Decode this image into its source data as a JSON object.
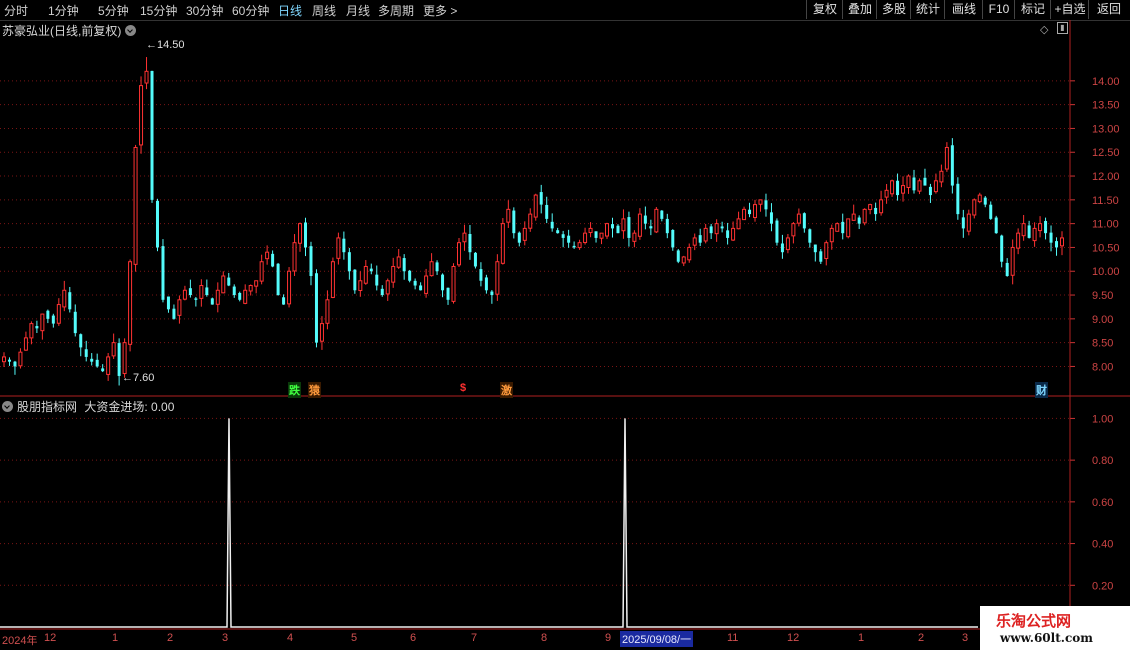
{
  "toolbar": {
    "periods": [
      "分时",
      "1分钟",
      "5分钟",
      "15分钟",
      "30分钟",
      "60分钟",
      "日线",
      "周线",
      "月线",
      "多周期",
      "更多"
    ],
    "active_period": "日线",
    "buttons": [
      "复权",
      "叠加",
      "多股",
      "统计",
      "画线",
      "F10",
      "标记",
      "+自选",
      "返回"
    ]
  },
  "main": {
    "title": "苏豪弘业(日线,前复权)",
    "high_label": "14.50",
    "low_label": "7.60",
    "signals": [
      {
        "text": "跌",
        "color": "#40ff40"
      },
      {
        "text": "猿",
        "color": "#ff9a3c"
      },
      {
        "text": "$",
        "color": "#ff3030"
      },
      {
        "text": "激",
        "color": "#ff9a3c"
      },
      {
        "text": "财",
        "color": "#7fd7ff"
      }
    ]
  },
  "indicator": {
    "title": "股朋指标网",
    "name_value": "大资金进场: 0.00"
  },
  "dates": {
    "labels": [
      "2024年",
      "12",
      "1",
      "2",
      "3",
      "4",
      "5",
      "6",
      "7",
      "8",
      "9",
      "2025/09/08/一",
      "11",
      "12",
      "1",
      "2",
      "3"
    ],
    "selected": "2025/09/08/一"
  },
  "watermark": {
    "line1": "乐淘公式网",
    "line2": "www.60lt.com"
  },
  "chart_data": [
    {
      "type": "candlestick",
      "title": "苏豪弘业(日线,前复权)",
      "y_ticks": [
        "8.00",
        "8.50",
        "9.00",
        "9.50",
        "10.00",
        "10.50",
        "11.00",
        "11.50",
        "12.00",
        "12.50",
        "13.00",
        "13.50",
        "14.00"
      ],
      "ylim": [
        7.4,
        14.9
      ],
      "max": 14.5,
      "min": 7.6,
      "grid": true,
      "closes": [
        8.2,
        8.1,
        8.0,
        8.3,
        8.6,
        8.9,
        8.8,
        9.1,
        9.0,
        8.9,
        9.3,
        9.6,
        9.2,
        8.7,
        8.4,
        8.2,
        8.1,
        8.0,
        7.9,
        8.2,
        8.5,
        7.8,
        8.5,
        10.2,
        12.6,
        13.9,
        14.2,
        11.5,
        10.5,
        9.4,
        9.2,
        9.0,
        9.4,
        9.6,
        9.5,
        9.4,
        9.7,
        9.5,
        9.3,
        9.6,
        9.9,
        9.7,
        9.5,
        9.4,
        9.6,
        9.7,
        9.8,
        10.2,
        10.4,
        10.1,
        9.5,
        9.3,
        10.0,
        10.6,
        11.0,
        10.5,
        9.9,
        8.5,
        8.9,
        9.4,
        10.2,
        10.7,
        10.4,
        10.0,
        9.6,
        9.8,
        10.1,
        10.0,
        9.7,
        9.5,
        9.8,
        10.1,
        10.3,
        10.0,
        9.8,
        9.7,
        9.6,
        9.9,
        10.2,
        10.0,
        9.6,
        9.4,
        10.1,
        10.6,
        10.8,
        10.4,
        10.1,
        9.8,
        9.6,
        9.5,
        10.2,
        11.0,
        11.3,
        10.8,
        10.6,
        10.9,
        11.2,
        11.6,
        11.4,
        11.1,
        10.9,
        10.8,
        10.7,
        10.6,
        10.5,
        10.6,
        10.8,
        10.9,
        10.7,
        10.8,
        11.0,
        10.9,
        10.8,
        11.1,
        10.7,
        10.8,
        11.2,
        11.0,
        10.9,
        11.3,
        11.1,
        10.8,
        10.5,
        10.2,
        10.3,
        10.5,
        10.7,
        10.6,
        10.9,
        10.8,
        11.0,
        10.9,
        10.7,
        10.9,
        11.1,
        11.3,
        11.2,
        11.4,
        11.5,
        11.3,
        11.0,
        10.6,
        10.4,
        10.7,
        11.0,
        11.2,
        10.9,
        10.6,
        10.4,
        10.2,
        10.6,
        10.9,
        11.0,
        10.8,
        11.1,
        11.2,
        11.0,
        11.3,
        11.4,
        11.2,
        11.5,
        11.7,
        11.9,
        11.6,
        11.8,
        12.0,
        11.7,
        11.9,
        11.8,
        11.6,
        11.9,
        12.1,
        12.6,
        11.8,
        11.2,
        10.9,
        11.2,
        11.5,
        11.6,
        11.4,
        11.1,
        10.8,
        10.2,
        9.9,
        10.5,
        10.8,
        11.0,
        10.7,
        10.9,
        11.0,
        10.8,
        10.6,
        10.5,
        10.7
      ]
    },
    {
      "type": "line",
      "title": "大资金进场",
      "y_ticks": [
        "0.20",
        "0.40",
        "0.60",
        "0.80",
        "1.00"
      ],
      "ylim": [
        0,
        1.05
      ],
      "spikes_at": [
        "2025-03",
        "2025-09"
      ],
      "values": [
        0,
        1,
        0,
        1,
        0
      ]
    }
  ]
}
